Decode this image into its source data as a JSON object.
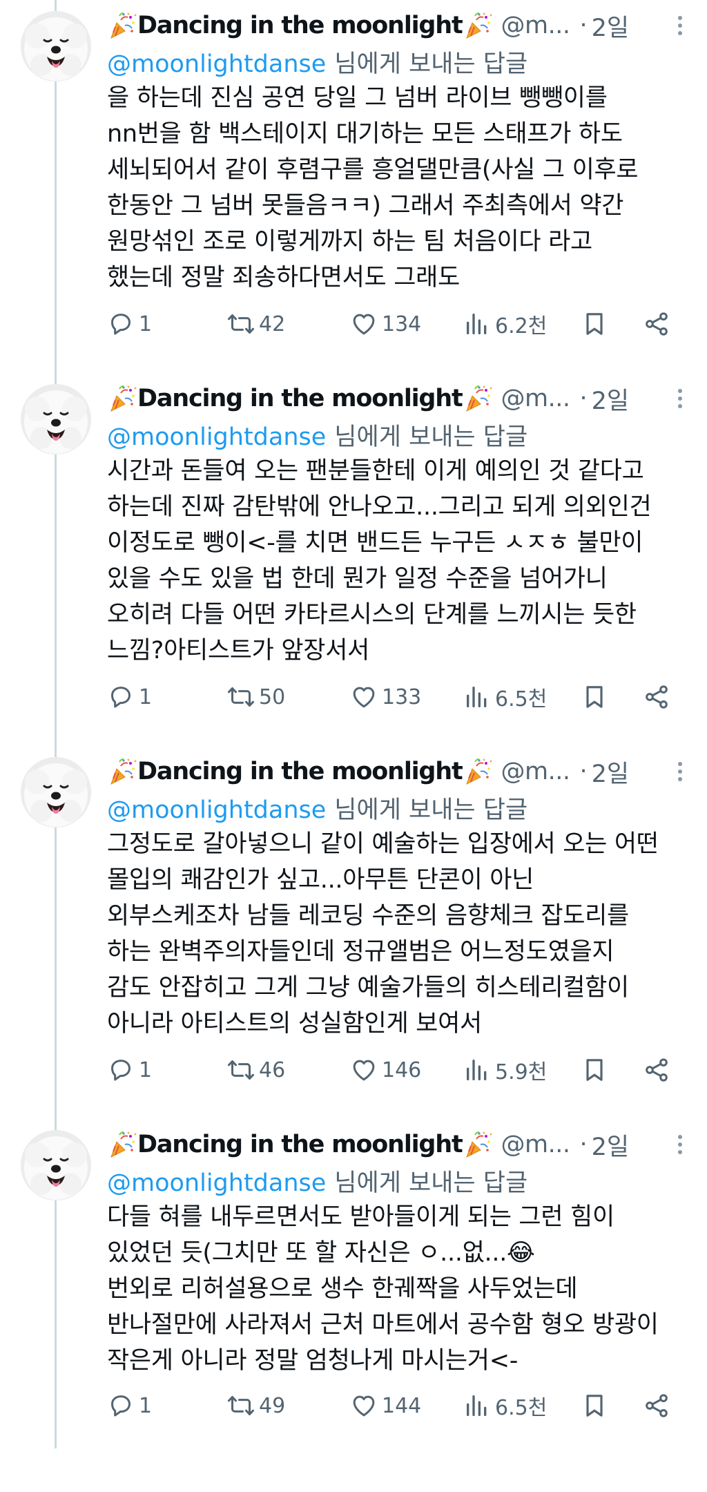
{
  "colors": {
    "text": "#0f1419",
    "secondary": "#536471",
    "link": "#1d9bf0",
    "thread_line": "#cfd9de"
  },
  "tweets": [
    {
      "name": "Dancing in the moonlight",
      "handle": "@m...",
      "time": "2일",
      "reply_to": "@moonlightdanse",
      "reply_suffix": "님에게 보내는 답글",
      "lines": [
        "을 하는데 진심 공연 당일 그 넘버 라이브 뺑뺑이를",
        "nn번을 함 백스테이지 대기하는 모든 스태프가 하도",
        "세뇌되어서 같이 후렴구를 흥얼댈만큼(사실 그 이후로",
        "한동안 그 넘버 못들음ㅋㅋ) 그래서 주최측에서 약간",
        "원망섞인 조로 이렇게까지 하는 팀 처음이다 라고",
        "했는데 정말 죄송하다면서도 그래도"
      ],
      "replies": "1",
      "retweets": "42",
      "likes": "134",
      "views": "6.2천"
    },
    {
      "name": "Dancing in the moonlight",
      "handle": "@m...",
      "time": "2일",
      "reply_to": "@moonlightdanse",
      "reply_suffix": "님에게 보내는 답글",
      "lines": [
        "시간과 돈들여 오는 팬분들한테 이게 예의인 것 같다고",
        "하는데 진짜 감탄밖에 안나오고...그리고 되게 의외인건",
        "이정도로 뺑이<-를 치면 밴드든 누구든 ㅅㅈㅎ 불만이",
        "있을 수도 있을 법 한데 뭔가 일정 수준을 넘어가니",
        "오히려 다들 어떤 카타르시스의 단계를 느끼시는 듯한",
        "느낌?아티스트가 앞장서서"
      ],
      "replies": "1",
      "retweets": "50",
      "likes": "133",
      "views": "6.5천"
    },
    {
      "name": "Dancing in the moonlight",
      "handle": "@m...",
      "time": "2일",
      "reply_to": "@moonlightdanse",
      "reply_suffix": "님에게 보내는 답글",
      "lines": [
        "그정도로 갈아넣으니 같이 예술하는 입장에서 오는 어떤",
        "몰입의 쾌감인가 싶고...아무튼 단콘이 아닌",
        "외부스케조차 남들 레코딩 수준의 음향체크 잡도리를",
        "하는 완벽주의자들인데 정규앨범은 어느정도였을지",
        "감도 안잡히고 그게 그냥 예술가들의 히스테리컬함이",
        "아니라 아티스트의 성실함인게 보여서"
      ],
      "replies": "1",
      "retweets": "46",
      "likes": "146",
      "views": "5.9천"
    },
    {
      "name": "Dancing in the moonlight",
      "handle": "@m...",
      "time": "2일",
      "reply_to": "@moonlightdanse",
      "reply_suffix": "님에게 보내는 답글",
      "lines": [
        "다들 혀를 내두르면서도 받아들이게 되는 그런 힘이",
        "있었던 듯(그치만 또 할 자신은 ㅇ...없...😂",
        "번외로 리허설용으로 생수 한궤짝을 사두었는데",
        "반나절만에 사라져서 근처 마트에서 공수함 형오 방광이",
        "작은게 아니라 정말 엄청나게 마시는거<-"
      ],
      "replies": "1",
      "retweets": "49",
      "likes": "144",
      "views": "6.5천"
    }
  ]
}
